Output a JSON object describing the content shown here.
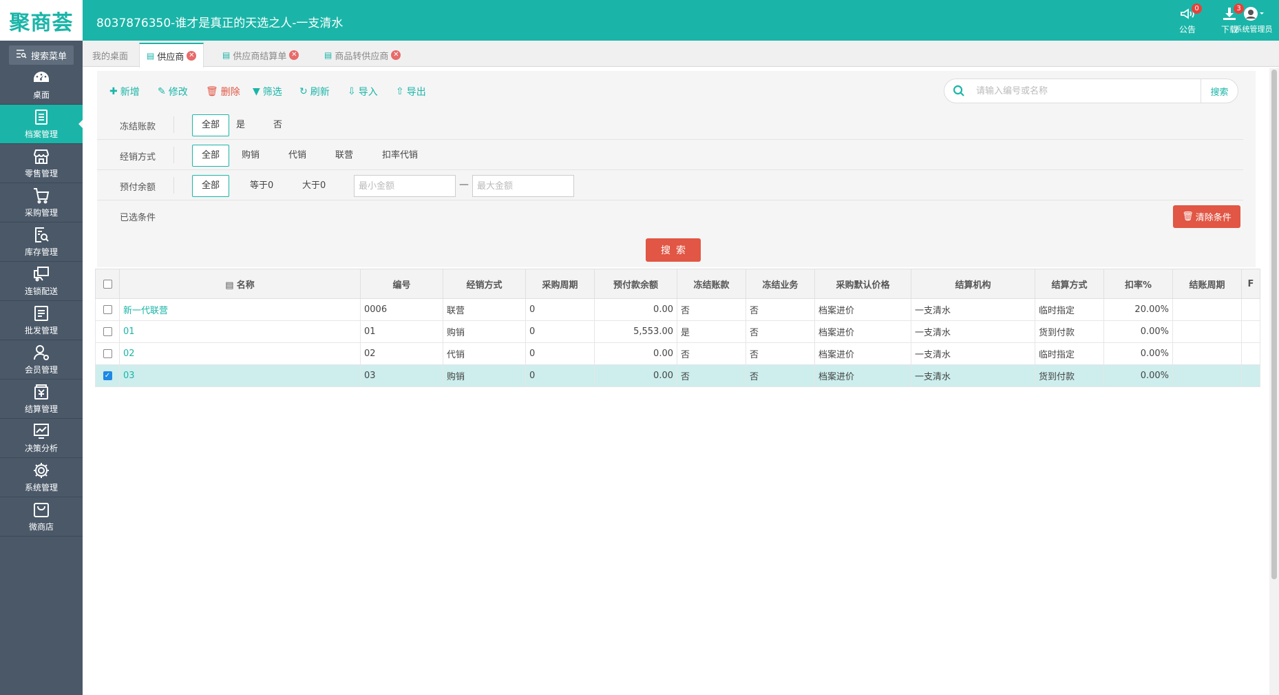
{
  "brand": {
    "logo_text": "聚商荟",
    "title": "8037876350-谁才是真正的天选之人-一支清水"
  },
  "top_tools": [
    {
      "label": "公告",
      "badge": "0",
      "icon": "megaphone-icon"
    },
    {
      "label": "下载",
      "badge": "3",
      "icon": "download-icon"
    },
    {
      "label": "系统管理员",
      "icon": "avatar-icon"
    }
  ],
  "sidebar": {
    "search_label": "搜索菜单",
    "items": [
      {
        "label": "桌面",
        "icon": "dashboard-icon"
      },
      {
        "label": "档案管理",
        "icon": "archive-icon",
        "active": true
      },
      {
        "label": "零售管理",
        "icon": "store-icon"
      },
      {
        "label": "采购管理",
        "icon": "cart-icon"
      },
      {
        "label": "库存管理",
        "icon": "inventory-search-icon"
      },
      {
        "label": "连锁配送",
        "icon": "delivery-icon"
      },
      {
        "label": "批发管理",
        "icon": "wholesale-icon"
      },
      {
        "label": "会员管理",
        "icon": "member-icon"
      },
      {
        "label": "结算管理",
        "icon": "settlement-icon"
      },
      {
        "label": "决策分析",
        "icon": "chart-icon"
      },
      {
        "label": "系统管理",
        "icon": "gear-icon"
      },
      {
        "label": "微商店",
        "icon": "shop-bag-icon"
      }
    ]
  },
  "tabs": [
    {
      "label": "我的桌面"
    },
    {
      "label": "供应商",
      "active": true
    },
    {
      "label": "供应商结算单"
    },
    {
      "label": "商品转供应商"
    }
  ],
  "toolbar": {
    "add": "新增",
    "edit": "修改",
    "delete": "删除",
    "filter": "筛选",
    "refresh": "刷新",
    "import": "导入",
    "export": "导出"
  },
  "search": {
    "placeholder": "请输入编号或名称",
    "button": "搜索"
  },
  "filters": {
    "freeze_account": {
      "label": "冻结账款",
      "options": [
        "全部",
        "是",
        "否"
      ],
      "selected": "全部"
    },
    "sales_mode": {
      "label": "经销方式",
      "options": [
        "全部",
        "购销",
        "代销",
        "联营",
        "扣率代销"
      ],
      "selected": "全部"
    },
    "prepaid_balance": {
      "label": "预付余额",
      "options": [
        "全部",
        "等于0",
        "大于0"
      ],
      "selected": "全部",
      "min_placeholder": "最小金额",
      "max_placeholder": "最大金额",
      "dash": "—"
    },
    "selected_conditions": {
      "label": "已选条件"
    },
    "clear_button": "清除条件",
    "search_button": "搜索"
  },
  "table": {
    "columns": [
      "名称",
      "编号",
      "经销方式",
      "采购周期",
      "预付款余额",
      "冻结账款",
      "冻结业务",
      "采购默认价格",
      "结算机构",
      "结算方式",
      "扣率%",
      "结账周期",
      "F"
    ],
    "rows": [
      {
        "checked": false,
        "name": "新一代联营",
        "code": "0006",
        "mode": "联营",
        "cycle": "0",
        "balance": "0.00",
        "freeze_acct": "否",
        "freeze_biz": "否",
        "price": "档案进价",
        "org": "一支清水",
        "settle": "临时指定",
        "rate": "20.00%",
        "period": ""
      },
      {
        "checked": false,
        "name": "01",
        "code": "01",
        "mode": "购销",
        "cycle": "0",
        "balance": "5,553.00",
        "freeze_acct": "是",
        "freeze_biz": "否",
        "price": "档案进价",
        "org": "一支清水",
        "settle": "货到付款",
        "rate": "0.00%",
        "period": ""
      },
      {
        "checked": false,
        "name": "02",
        "code": "02",
        "mode": "代销",
        "cycle": "0",
        "balance": "0.00",
        "freeze_acct": "否",
        "freeze_biz": "否",
        "price": "档案进价",
        "org": "一支清水",
        "settle": "临时指定",
        "rate": "0.00%",
        "period": ""
      },
      {
        "checked": true,
        "name": "03",
        "code": "03",
        "mode": "购销",
        "cycle": "0",
        "balance": "0.00",
        "freeze_acct": "否",
        "freeze_biz": "否",
        "price": "档案进价",
        "org": "一支清水",
        "settle": "货到付款",
        "rate": "0.00%",
        "period": ""
      }
    ]
  },
  "colors": {
    "accent": "#1ab5a8",
    "sidebar": "#4a5868",
    "danger": "#e15644"
  }
}
